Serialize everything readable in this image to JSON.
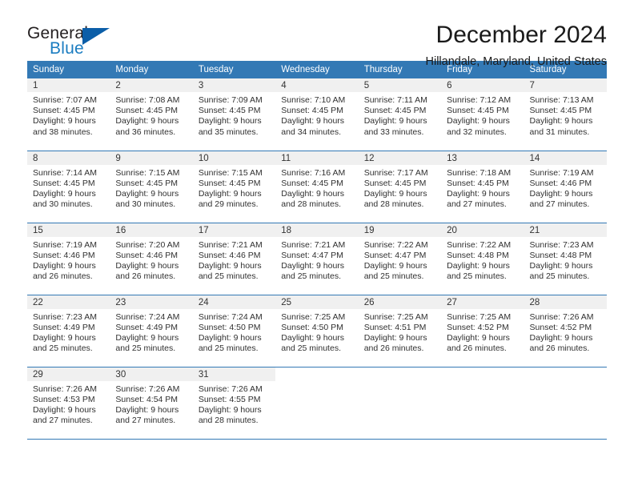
{
  "brand": {
    "name_top": "General",
    "name_bottom": "Blue",
    "accent_color": "#0b5ea8",
    "blue_text_color": "#1b7dc1"
  },
  "header": {
    "title": "December 2024",
    "subtitle": "Hillandale, Maryland, United States"
  },
  "theme": {
    "header_row_bg": "#3379b5",
    "daynum_bg": "#f0f0f0",
    "grid_line": "#3379b5",
    "page_bg": "#ffffff",
    "text": "#303030"
  },
  "weekday_headers": [
    "Sunday",
    "Monday",
    "Tuesday",
    "Wednesday",
    "Thursday",
    "Friday",
    "Saturday"
  ],
  "labels": {
    "sunrise_prefix": "Sunrise:",
    "sunset_prefix": "Sunset:",
    "daylight_prefix": "Daylight:"
  },
  "weeks": [
    [
      {
        "day": "1",
        "sunrise": "Sunrise: 7:07 AM",
        "sunset": "Sunset: 4:45 PM",
        "daylight_line1": "Daylight: 9 hours",
        "daylight_line2": "and 38 minutes."
      },
      {
        "day": "2",
        "sunrise": "Sunrise: 7:08 AM",
        "sunset": "Sunset: 4:45 PM",
        "daylight_line1": "Daylight: 9 hours",
        "daylight_line2": "and 36 minutes."
      },
      {
        "day": "3",
        "sunrise": "Sunrise: 7:09 AM",
        "sunset": "Sunset: 4:45 PM",
        "daylight_line1": "Daylight: 9 hours",
        "daylight_line2": "and 35 minutes."
      },
      {
        "day": "4",
        "sunrise": "Sunrise: 7:10 AM",
        "sunset": "Sunset: 4:45 PM",
        "daylight_line1": "Daylight: 9 hours",
        "daylight_line2": "and 34 minutes."
      },
      {
        "day": "5",
        "sunrise": "Sunrise: 7:11 AM",
        "sunset": "Sunset: 4:45 PM",
        "daylight_line1": "Daylight: 9 hours",
        "daylight_line2": "and 33 minutes."
      },
      {
        "day": "6",
        "sunrise": "Sunrise: 7:12 AM",
        "sunset": "Sunset: 4:45 PM",
        "daylight_line1": "Daylight: 9 hours",
        "daylight_line2": "and 32 minutes."
      },
      {
        "day": "7",
        "sunrise": "Sunrise: 7:13 AM",
        "sunset": "Sunset: 4:45 PM",
        "daylight_line1": "Daylight: 9 hours",
        "daylight_line2": "and 31 minutes."
      }
    ],
    [
      {
        "day": "8",
        "sunrise": "Sunrise: 7:14 AM",
        "sunset": "Sunset: 4:45 PM",
        "daylight_line1": "Daylight: 9 hours",
        "daylight_line2": "and 30 minutes."
      },
      {
        "day": "9",
        "sunrise": "Sunrise: 7:15 AM",
        "sunset": "Sunset: 4:45 PM",
        "daylight_line1": "Daylight: 9 hours",
        "daylight_line2": "and 30 minutes."
      },
      {
        "day": "10",
        "sunrise": "Sunrise: 7:15 AM",
        "sunset": "Sunset: 4:45 PM",
        "daylight_line1": "Daylight: 9 hours",
        "daylight_line2": "and 29 minutes."
      },
      {
        "day": "11",
        "sunrise": "Sunrise: 7:16 AM",
        "sunset": "Sunset: 4:45 PM",
        "daylight_line1": "Daylight: 9 hours",
        "daylight_line2": "and 28 minutes."
      },
      {
        "day": "12",
        "sunrise": "Sunrise: 7:17 AM",
        "sunset": "Sunset: 4:45 PM",
        "daylight_line1": "Daylight: 9 hours",
        "daylight_line2": "and 28 minutes."
      },
      {
        "day": "13",
        "sunrise": "Sunrise: 7:18 AM",
        "sunset": "Sunset: 4:45 PM",
        "daylight_line1": "Daylight: 9 hours",
        "daylight_line2": "and 27 minutes."
      },
      {
        "day": "14",
        "sunrise": "Sunrise: 7:19 AM",
        "sunset": "Sunset: 4:46 PM",
        "daylight_line1": "Daylight: 9 hours",
        "daylight_line2": "and 27 minutes."
      }
    ],
    [
      {
        "day": "15",
        "sunrise": "Sunrise: 7:19 AM",
        "sunset": "Sunset: 4:46 PM",
        "daylight_line1": "Daylight: 9 hours",
        "daylight_line2": "and 26 minutes."
      },
      {
        "day": "16",
        "sunrise": "Sunrise: 7:20 AM",
        "sunset": "Sunset: 4:46 PM",
        "daylight_line1": "Daylight: 9 hours",
        "daylight_line2": "and 26 minutes."
      },
      {
        "day": "17",
        "sunrise": "Sunrise: 7:21 AM",
        "sunset": "Sunset: 4:46 PM",
        "daylight_line1": "Daylight: 9 hours",
        "daylight_line2": "and 25 minutes."
      },
      {
        "day": "18",
        "sunrise": "Sunrise: 7:21 AM",
        "sunset": "Sunset: 4:47 PM",
        "daylight_line1": "Daylight: 9 hours",
        "daylight_line2": "and 25 minutes."
      },
      {
        "day": "19",
        "sunrise": "Sunrise: 7:22 AM",
        "sunset": "Sunset: 4:47 PM",
        "daylight_line1": "Daylight: 9 hours",
        "daylight_line2": "and 25 minutes."
      },
      {
        "day": "20",
        "sunrise": "Sunrise: 7:22 AM",
        "sunset": "Sunset: 4:48 PM",
        "daylight_line1": "Daylight: 9 hours",
        "daylight_line2": "and 25 minutes."
      },
      {
        "day": "21",
        "sunrise": "Sunrise: 7:23 AM",
        "sunset": "Sunset: 4:48 PM",
        "daylight_line1": "Daylight: 9 hours",
        "daylight_line2": "and 25 minutes."
      }
    ],
    [
      {
        "day": "22",
        "sunrise": "Sunrise: 7:23 AM",
        "sunset": "Sunset: 4:49 PM",
        "daylight_line1": "Daylight: 9 hours",
        "daylight_line2": "and 25 minutes."
      },
      {
        "day": "23",
        "sunrise": "Sunrise: 7:24 AM",
        "sunset": "Sunset: 4:49 PM",
        "daylight_line1": "Daylight: 9 hours",
        "daylight_line2": "and 25 minutes."
      },
      {
        "day": "24",
        "sunrise": "Sunrise: 7:24 AM",
        "sunset": "Sunset: 4:50 PM",
        "daylight_line1": "Daylight: 9 hours",
        "daylight_line2": "and 25 minutes."
      },
      {
        "day": "25",
        "sunrise": "Sunrise: 7:25 AM",
        "sunset": "Sunset: 4:50 PM",
        "daylight_line1": "Daylight: 9 hours",
        "daylight_line2": "and 25 minutes."
      },
      {
        "day": "26",
        "sunrise": "Sunrise: 7:25 AM",
        "sunset": "Sunset: 4:51 PM",
        "daylight_line1": "Daylight: 9 hours",
        "daylight_line2": "and 26 minutes."
      },
      {
        "day": "27",
        "sunrise": "Sunrise: 7:25 AM",
        "sunset": "Sunset: 4:52 PM",
        "daylight_line1": "Daylight: 9 hours",
        "daylight_line2": "and 26 minutes."
      },
      {
        "day": "28",
        "sunrise": "Sunrise: 7:26 AM",
        "sunset": "Sunset: 4:52 PM",
        "daylight_line1": "Daylight: 9 hours",
        "daylight_line2": "and 26 minutes."
      }
    ],
    [
      {
        "day": "29",
        "sunrise": "Sunrise: 7:26 AM",
        "sunset": "Sunset: 4:53 PM",
        "daylight_line1": "Daylight: 9 hours",
        "daylight_line2": "and 27 minutes."
      },
      {
        "day": "30",
        "sunrise": "Sunrise: 7:26 AM",
        "sunset": "Sunset: 4:54 PM",
        "daylight_line1": "Daylight: 9 hours",
        "daylight_line2": "and 27 minutes."
      },
      {
        "day": "31",
        "sunrise": "Sunrise: 7:26 AM",
        "sunset": "Sunset: 4:55 PM",
        "daylight_line1": "Daylight: 9 hours",
        "daylight_line2": "and 28 minutes."
      },
      {
        "day": "",
        "sunrise": "",
        "sunset": "",
        "daylight_line1": "",
        "daylight_line2": ""
      },
      {
        "day": "",
        "sunrise": "",
        "sunset": "",
        "daylight_line1": "",
        "daylight_line2": ""
      },
      {
        "day": "",
        "sunrise": "",
        "sunset": "",
        "daylight_line1": "",
        "daylight_line2": ""
      },
      {
        "day": "",
        "sunrise": "",
        "sunset": "",
        "daylight_line1": "",
        "daylight_line2": ""
      }
    ]
  ]
}
